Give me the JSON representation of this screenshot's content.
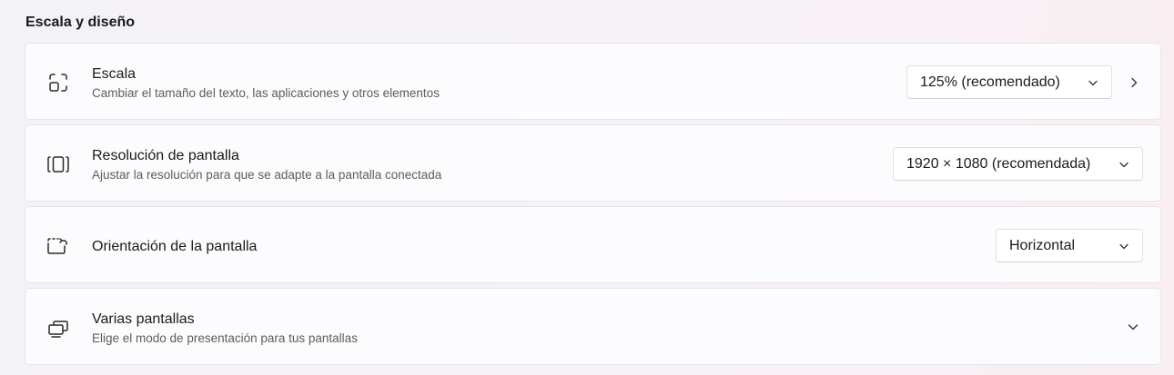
{
  "section": {
    "title": "Escala y diseño"
  },
  "scale": {
    "title": "Escala",
    "subtitle": "Cambiar el tamaño del texto, las aplicaciones y otros elementos",
    "value": "125% (recomendado)",
    "icon": "scale-icon"
  },
  "resolution": {
    "title": "Resolución de pantalla",
    "subtitle": "Ajustar la resolución para que se adapte a la pantalla conectada",
    "value": "1920 × 1080 (recomendada)",
    "icon": "display-resolution-icon"
  },
  "orientation": {
    "title": "Orientación de la pantalla",
    "value": "Horizontal",
    "icon": "screen-rotation-icon"
  },
  "multiple_displays": {
    "title": "Varias pantallas",
    "subtitle": "Elige el modo de presentación para tus pantallas",
    "icon": "multiple-displays-icon"
  }
}
